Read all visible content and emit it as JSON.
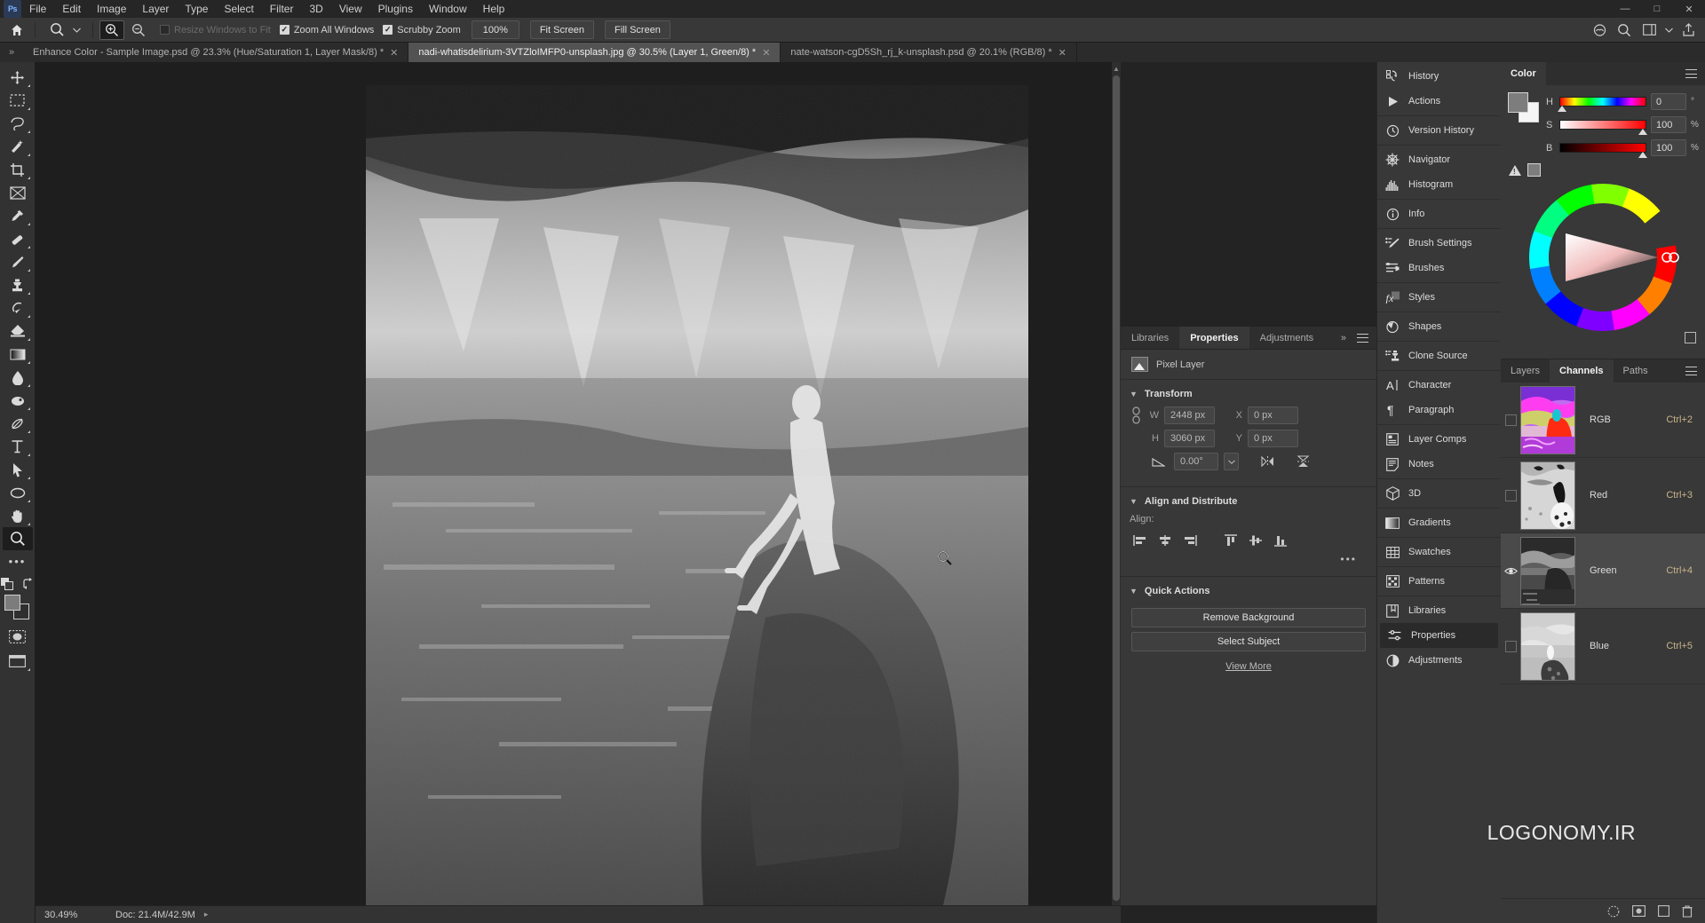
{
  "app": {
    "logo": "Ps"
  },
  "menubar": {
    "items": [
      "File",
      "Edit",
      "Image",
      "Layer",
      "Type",
      "Select",
      "Filter",
      "3D",
      "View",
      "Plugins",
      "Window",
      "Help"
    ],
    "window_controls": [
      "minimize",
      "maximize",
      "close"
    ]
  },
  "optionsbar": {
    "home_icon": "home-icon",
    "tool_icon": "zoom-tool-icon",
    "tool_dropdown": "chevron-down-icon",
    "zoom_in_icon": "zoom-in-icon",
    "zoom_out_icon": "zoom-out-icon",
    "resize_windows": {
      "label": "Resize Windows to Fit",
      "checked": false,
      "enabled": false
    },
    "zoom_all_windows": {
      "label": "Zoom All Windows",
      "checked": true,
      "enabled": true
    },
    "scrubby_zoom": {
      "label": "Scrubby Zoom",
      "checked": true,
      "enabled": true
    },
    "buttons": [
      "100%",
      "Fit Screen",
      "Fill Screen"
    ],
    "right_icons": [
      "cloud-documents-icon",
      "search-icon",
      "workspace-icon",
      "chevron-down-icon",
      "share-icon"
    ]
  },
  "tabbar": {
    "collapse_icon": "double-chevron-right-icon",
    "tabs": [
      {
        "label": "Enhance Color - Sample Image.psd @ 23.3% (Hue/Saturation 1, Layer Mask/8) *",
        "active": false
      },
      {
        "label": "nadi-whatisdelirium-3VTZloIMFP0-unsplash.jpg @ 30.5% (Layer 1, Green/8) *",
        "active": true
      },
      {
        "label": "nate-watson-cgD5Sh_rj_k-unsplash.psd @ 20.1% (RGB/8) *",
        "active": false
      }
    ]
  },
  "toolbar": {
    "tools": [
      {
        "name": "move-tool",
        "glyph": "✥",
        "active": false,
        "hasMore": true
      },
      {
        "name": "rectangular-marquee-tool",
        "glyph": "▭",
        "active": false,
        "hasMore": true
      },
      {
        "name": "lasso-tool",
        "glyph": "✑",
        "active": false,
        "hasMore": true
      },
      {
        "name": "object-selection-tool",
        "glyph": "✨",
        "active": false,
        "hasMore": true
      },
      {
        "name": "crop-tool",
        "glyph": "⌗",
        "active": false,
        "hasMore": true
      },
      {
        "name": "frame-tool",
        "glyph": "⊠",
        "active": false,
        "hasMore": false
      },
      {
        "name": "eyedropper-tool",
        "glyph": "⌁",
        "active": false,
        "hasMore": true
      },
      {
        "name": "spot-healing-brush-tool",
        "glyph": "⌯",
        "active": false,
        "hasMore": true
      },
      {
        "name": "brush-tool",
        "glyph": "⌇",
        "active": false,
        "hasMore": true
      },
      {
        "name": "clone-stamp-tool",
        "glyph": "⎙",
        "active": false,
        "hasMore": true
      },
      {
        "name": "history-brush-tool",
        "glyph": "⟲",
        "active": false,
        "hasMore": true
      },
      {
        "name": "eraser-tool",
        "glyph": "⌫",
        "active": false,
        "hasMore": true
      },
      {
        "name": "gradient-tool",
        "glyph": "▤",
        "active": false,
        "hasMore": true
      },
      {
        "name": "blur-tool",
        "glyph": "💧",
        "active": false,
        "hasMore": true
      },
      {
        "name": "dodge-tool",
        "glyph": "◗",
        "active": false,
        "hasMore": true
      },
      {
        "name": "pen-tool",
        "glyph": "✒",
        "active": false,
        "hasMore": true
      },
      {
        "name": "horizontal-type-tool",
        "glyph": "T",
        "active": false,
        "hasMore": true
      },
      {
        "name": "path-selection-tool",
        "glyph": "➤",
        "active": false,
        "hasMore": true
      },
      {
        "name": "ellipse-tool",
        "glyph": "⬭",
        "active": false,
        "hasMore": true
      },
      {
        "name": "hand-tool",
        "glyph": "✋",
        "active": false,
        "hasMore": true
      },
      {
        "name": "zoom-tool",
        "glyph": "🔍",
        "active": true,
        "hasMore": false
      }
    ],
    "more_tools": "…",
    "edit_toolbar_icon": "edit-toolbar-icon",
    "default_colors_icon": "default-colors-icon",
    "swap_colors_icon": "swap-colors-icon",
    "foreground_color": "#7c7c7c",
    "background_color": "#2f2f2f",
    "quick_mask_icon": "quick-mask-icon",
    "screen_mode_icon": "screen-mode-icon"
  },
  "statusbar": {
    "zoom": "30.49%",
    "doc_info": "Doc: 21.4M/42.9M",
    "expand_icon": "chevron-right-icon"
  },
  "properties": {
    "tabs": [
      {
        "label": "Libraries",
        "active": false
      },
      {
        "label": "Properties",
        "active": true
      },
      {
        "label": "Adjustments",
        "active": false
      }
    ],
    "collapse_icon": "double-chevron-right-icon",
    "menu_icon": "panel-menu-icon",
    "layer_type": "Pixel Layer",
    "layer_thumb_icon": "image-layer-icon",
    "transform": {
      "title": "Transform",
      "w_label": "W",
      "w_value": "2448 px",
      "h_label": "H",
      "h_value": "3060 px",
      "x_label": "X",
      "x_value": "0 px",
      "y_label": "Y",
      "y_value": "0 px",
      "angle_value": "0.00°",
      "link_icon": "link-chain-icon",
      "angle_icon": "angle-icon",
      "angle_dropdown_icon": "chevron-down-icon",
      "flip_horizontal_icon": "flip-horizontal-icon",
      "flip_vertical_icon": "flip-vertical-icon"
    },
    "align": {
      "title": "Align and Distribute",
      "sub_label": "Align:",
      "icons": [
        "align-left-icon",
        "align-center-horizontal-icon",
        "align-right-icon",
        "align-top-icon",
        "align-center-vertical-icon",
        "align-bottom-icon"
      ],
      "more": "•••"
    },
    "quick_actions": {
      "title": "Quick Actions",
      "buttons": [
        "Remove Background",
        "Select Subject"
      ],
      "view_more": "View More"
    }
  },
  "icondock": {
    "groups": [
      [
        {
          "label": "History",
          "icon": "history-icon",
          "active": false
        },
        {
          "label": "Actions",
          "icon": "actions-play-icon",
          "active": false
        }
      ],
      [
        {
          "label": "Version History",
          "icon": "version-history-clock-icon",
          "active": false
        }
      ],
      [
        {
          "label": "Navigator",
          "icon": "navigator-icon",
          "active": false
        },
        {
          "label": "Histogram",
          "icon": "histogram-icon",
          "active": false
        }
      ],
      [
        {
          "label": "Info",
          "icon": "info-icon",
          "active": false
        }
      ],
      [
        {
          "label": "Brush Settings",
          "icon": "brush-settings-icon",
          "active": false
        },
        {
          "label": "Brushes",
          "icon": "brushes-icon",
          "active": false
        }
      ],
      [
        {
          "label": "Styles",
          "icon": "styles-fx-icon",
          "active": false
        }
      ],
      [
        {
          "label": "Shapes",
          "icon": "shapes-icon",
          "active": false
        }
      ],
      [
        {
          "label": "Clone Source",
          "icon": "clone-source-icon",
          "active": false
        }
      ],
      [
        {
          "label": "Character",
          "icon": "character-icon",
          "active": false
        },
        {
          "label": "Paragraph",
          "icon": "paragraph-icon",
          "active": false
        }
      ],
      [
        {
          "label": "Layer Comps",
          "icon": "layer-comps-icon",
          "active": false
        },
        {
          "label": "Notes",
          "icon": "notes-icon",
          "active": false
        }
      ],
      [
        {
          "label": "3D",
          "icon": "cube-3d-icon",
          "active": false
        }
      ],
      [
        {
          "label": "Gradients",
          "icon": "gradients-icon",
          "active": false
        }
      ],
      [
        {
          "label": "Swatches",
          "icon": "swatches-grid-icon",
          "active": false
        }
      ],
      [
        {
          "label": "Patterns",
          "icon": "patterns-icon",
          "active": false
        }
      ],
      [
        {
          "label": "Libraries",
          "icon": "libraries-book-icon",
          "active": false
        },
        {
          "label": "Properties",
          "icon": "properties-sliders-icon",
          "active": true
        },
        {
          "label": "Adjustments",
          "icon": "adjustments-half-circle-icon",
          "active": false
        }
      ]
    ]
  },
  "color_panel": {
    "title": "Color",
    "menu_icon": "panel-menu-icon",
    "foreground_color": "#7d7d7d",
    "background_color": "#f5f5f5",
    "out_of_gamut_icon": "gamut-warning-icon",
    "gamut_swatch_color": "#7d7d7d",
    "sliders": [
      {
        "name": "H",
        "value": "0",
        "unit": "°",
        "knob_pct": 2
      },
      {
        "name": "S",
        "value": "100",
        "unit": "%",
        "knob_pct": 98
      },
      {
        "name": "B",
        "value": "100",
        "unit": "%",
        "knob_pct": 98
      }
    ],
    "picker_icon": "color-wheel-icon",
    "grid_icon": "color-grid-icon"
  },
  "channels_panel": {
    "tabs": [
      {
        "label": "Layers",
        "active": false
      },
      {
        "label": "Channels",
        "active": true
      },
      {
        "label": "Paths",
        "active": false
      }
    ],
    "menu_icon": "panel-menu-icon",
    "rows": [
      {
        "name": "RGB",
        "shortcut": "Ctrl+2",
        "visible": false,
        "selected": false,
        "thumb": "rgb-composite"
      },
      {
        "name": "Red",
        "shortcut": "Ctrl+3",
        "visible": false,
        "selected": false,
        "thumb": "red-channel"
      },
      {
        "name": "Green",
        "shortcut": "Ctrl+4",
        "visible": true,
        "selected": true,
        "thumb": "green-channel"
      },
      {
        "name": "Blue",
        "shortcut": "Ctrl+5",
        "visible": false,
        "selected": false,
        "thumb": "blue-channel"
      }
    ],
    "footer_icons": [
      "load-channel-as-selection-icon",
      "save-selection-as-channel-icon",
      "create-new-channel-icon",
      "delete-channel-icon"
    ]
  },
  "canvas": {
    "document_title": "nadi-whatisdelirium-3VTZloIMFP0-unsplash.jpg",
    "cursor_icon": "zoom-cursor-icon",
    "scrollbar_icon": "vertical-scrollbar"
  },
  "watermark": {
    "text": "LOGONOMY.IR"
  }
}
